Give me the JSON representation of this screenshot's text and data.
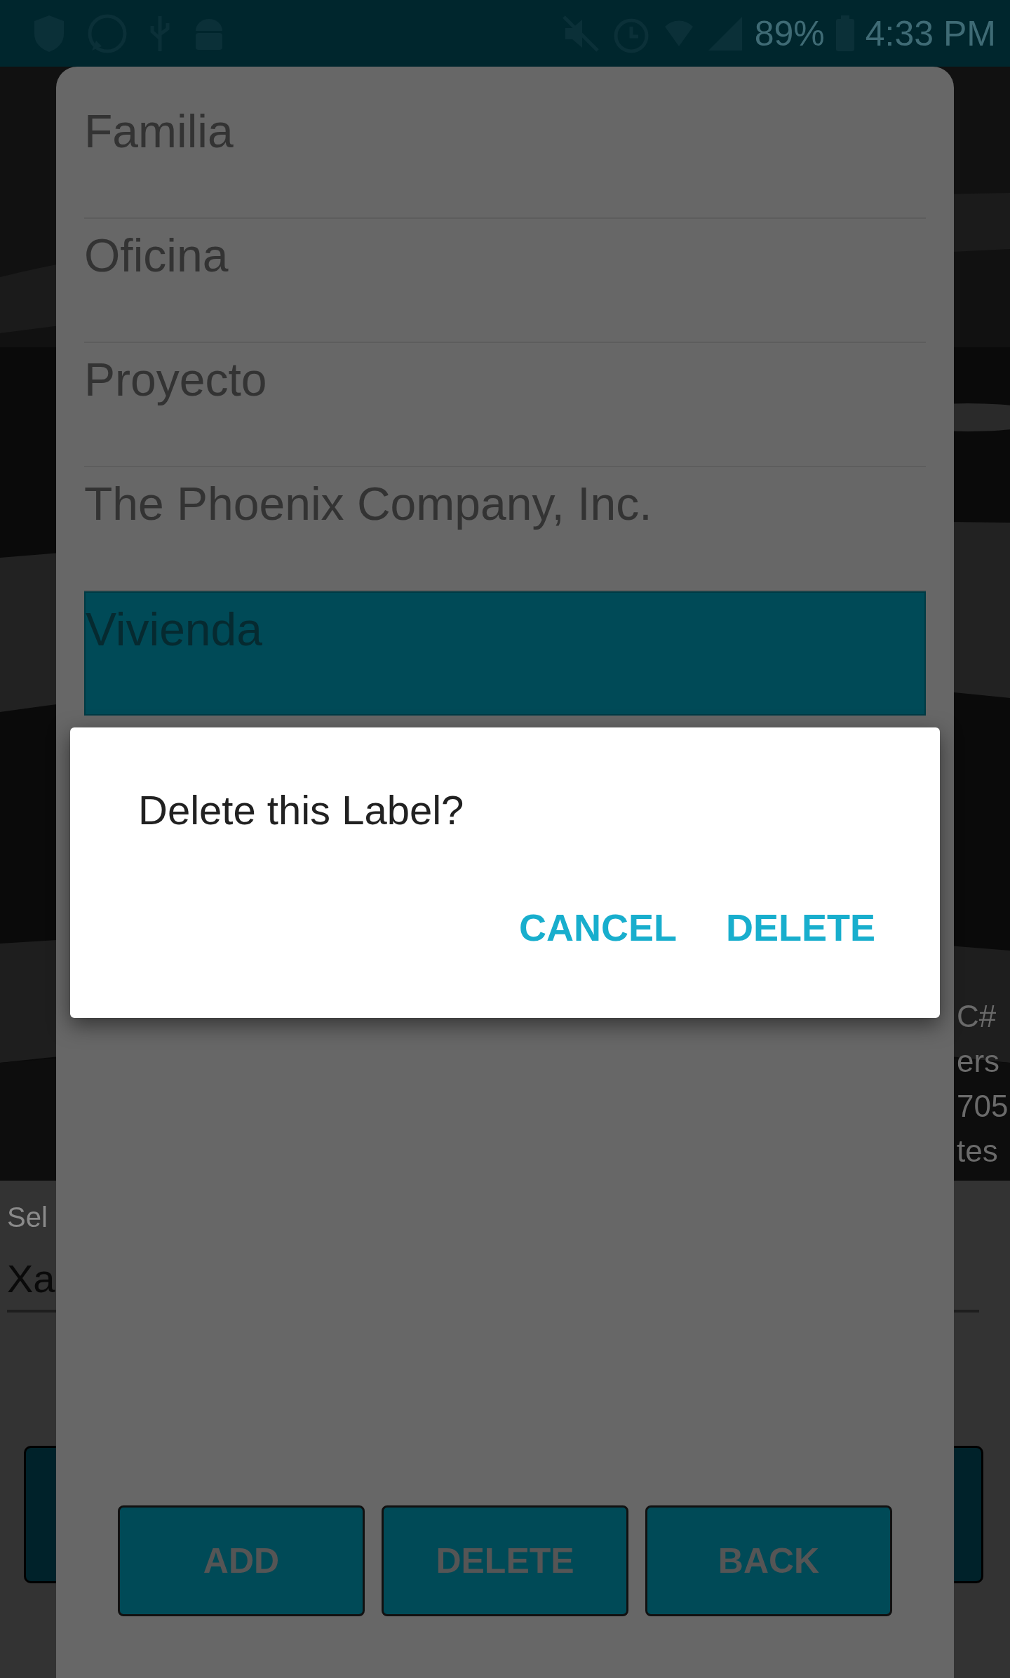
{
  "status_bar": {
    "battery": "89%",
    "time": "4:33 PM"
  },
  "background_page": {
    "side_text": [
      "C#",
      "ers",
      "705",
      "tes"
    ],
    "field_label": "Sel",
    "field_value": "Xa"
  },
  "labels_list": {
    "items": [
      {
        "label": "Familia",
        "selected": false
      },
      {
        "label": "Oficina",
        "selected": false
      },
      {
        "label": "Proyecto",
        "selected": false
      },
      {
        "label": "The Phoenix Company, Inc.",
        "selected": false
      },
      {
        "label": "Vivienda",
        "selected": true
      }
    ]
  },
  "buttons": [
    "ADD",
    "DELETE",
    "BACK"
  ],
  "alert": {
    "message": "Delete this Label?",
    "actions": [
      "CANCEL",
      "DELETE"
    ]
  }
}
